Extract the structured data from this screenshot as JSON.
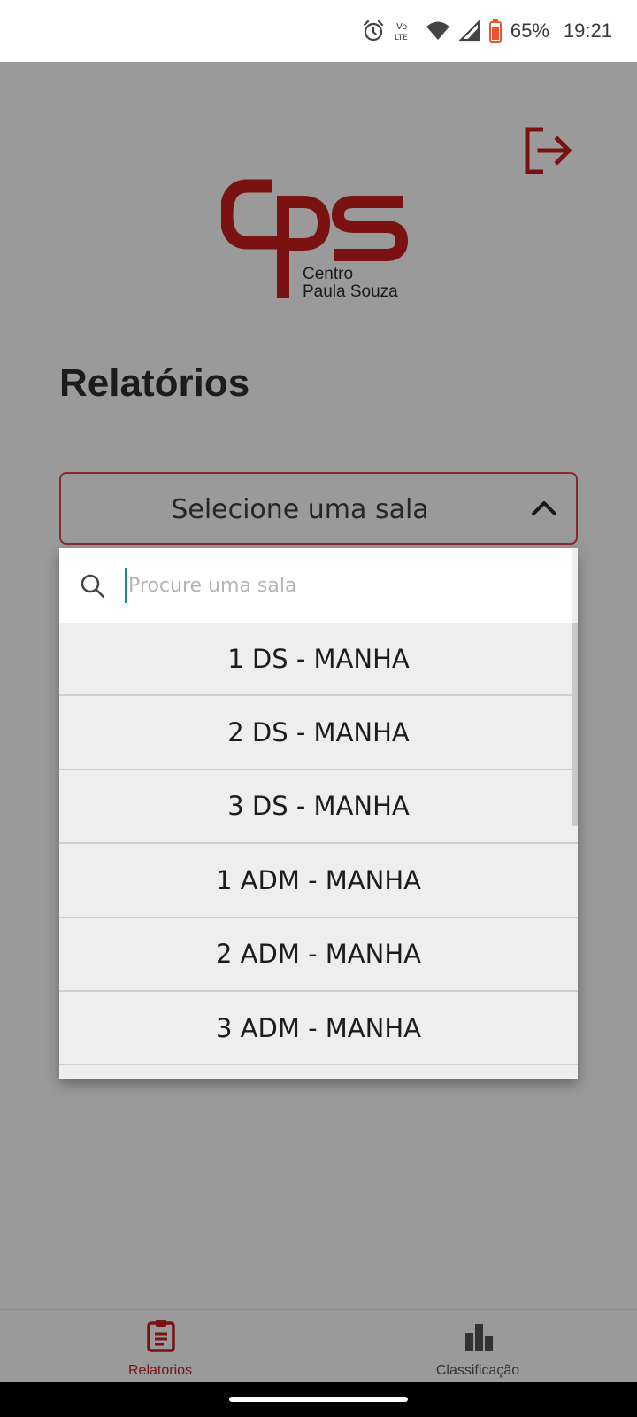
{
  "status_bar": {
    "icons": [
      "alarm-icon",
      "volte-icon",
      "wifi-icon",
      "signal-icon",
      "battery-icon"
    ],
    "volte_label": "Vo\nLTE",
    "battery_percent": "65%",
    "time": "19:21",
    "battery_color": "#e8542c"
  },
  "header": {
    "logo": {
      "letters": "cps",
      "line1": "Centro",
      "line2": "Paula Souza",
      "color": "#7a1212"
    },
    "logout_icon": "logout-icon"
  },
  "page": {
    "title": "Relatórios"
  },
  "room_select": {
    "label": "Selecione uma sala",
    "state": "open",
    "search": {
      "placeholder": "Procure uma sala",
      "value": ""
    },
    "options": [
      "1 DS - MANHA",
      "2 DS - MANHA",
      "3 DS - MANHA",
      "1 ADM - MANHA",
      "2 ADM - MANHA",
      "3 ADM - MANHA"
    ]
  },
  "bottom_nav": {
    "items": [
      {
        "label": "Relatorios",
        "icon": "clipboard-icon",
        "active": true,
        "color": "#7a1212"
      },
      {
        "label": "Classificação",
        "icon": "bar-chart-icon",
        "active": false,
        "color": "#333333"
      }
    ]
  },
  "colors": {
    "accent": "#7a1212",
    "overlay_background": "#9a9a9a",
    "select_border": "#8a2a2a"
  }
}
